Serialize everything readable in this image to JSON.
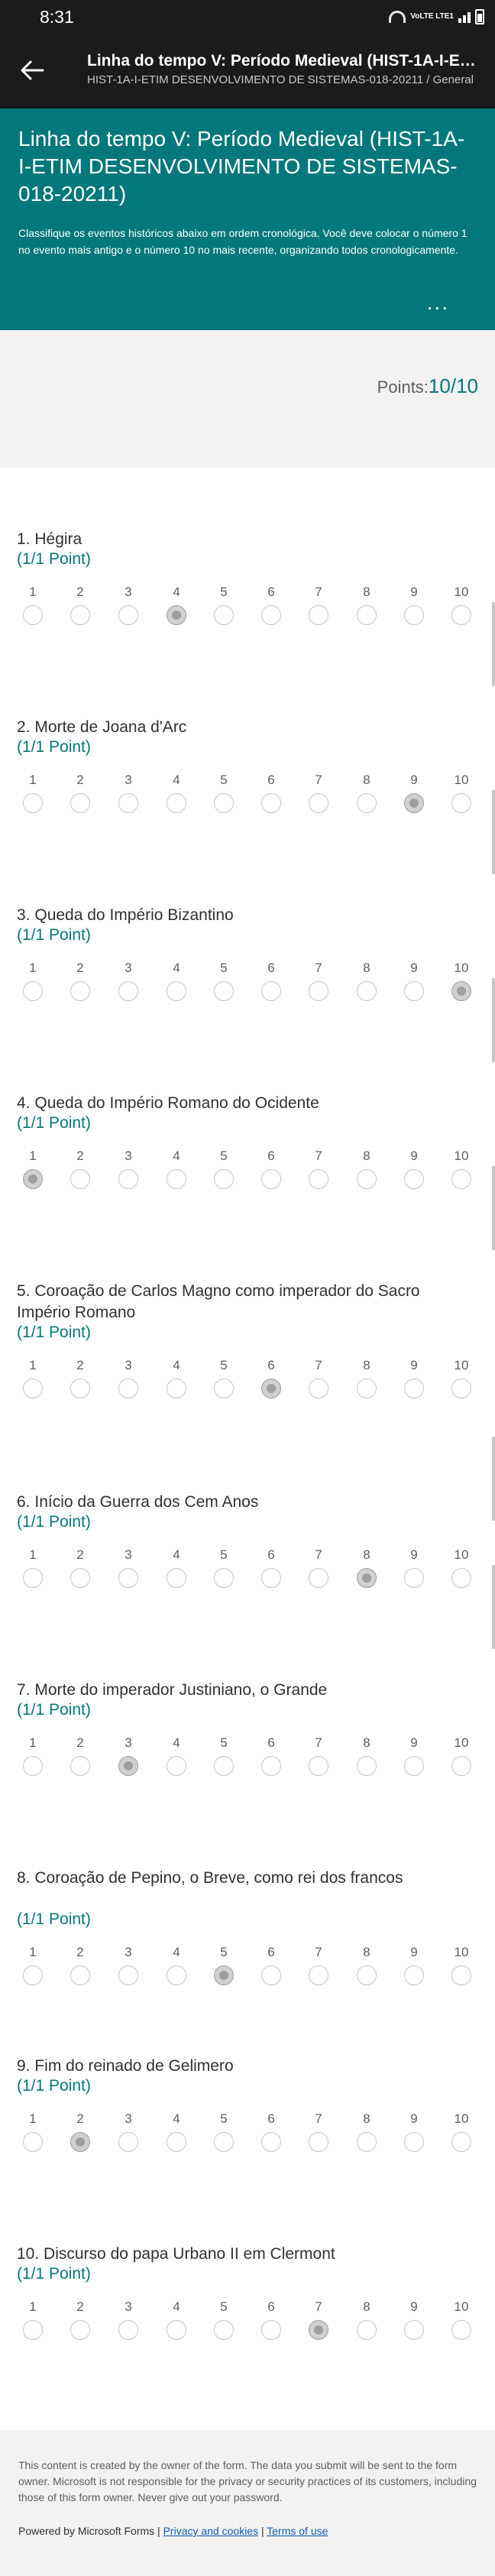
{
  "status_bar": {
    "time": "8:31",
    "network": "VoLTE LTE1"
  },
  "header": {
    "title": "Linha do tempo V: Período Medieval (HIST-1A-I-ETIM DES...",
    "subtitle": "HIST-1A-I-ETIM DESENVOLVIMENTO DE SISTEMAS-018-20211 / General"
  },
  "form": {
    "title": "Linha do tempo V: Período Medieval (HIST-1A-I-ETIM DESENVOLVIMENTO DE SISTEMAS-018-20211)",
    "description": "Classifique os eventos históricos abaixo em ordem cronológica. Você deve colocar o número 1 no evento mais antigo e o número 10 no mais recente, organizando todos cronologicamente.",
    "more_label": "...",
    "points_label": "Points:",
    "points_value": "10/10",
    "accent_color": "#03787c"
  },
  "scale_labels": [
    "1",
    "2",
    "3",
    "4",
    "5",
    "6",
    "7",
    "8",
    "9",
    "10"
  ],
  "questions": [
    {
      "number": "1.",
      "title": "Hégira",
      "points": "(1/1 Point)",
      "selected": 4
    },
    {
      "number": "2.",
      "title": "Morte de Joana d'Arc",
      "points": "(1/1 Point)",
      "selected": 9
    },
    {
      "number": "3.",
      "title": "Queda do Império Bizantino",
      "points": "(1/1 Point)",
      "selected": 10
    },
    {
      "number": "4.",
      "title": "Queda do Império Romano do Ocidente",
      "points": "(1/1 Point)",
      "selected": 1
    },
    {
      "number": "5.",
      "title": "Coroação de Carlos Magno como imperador do Sacro Império Romano",
      "points": "(1/1 Point)",
      "selected": 6
    },
    {
      "number": "6.",
      "title": "Início da Guerra dos Cem Anos",
      "points": "(1/1 Point)",
      "selected": 8
    },
    {
      "number": "7.",
      "title": "Morte do imperador Justiniano, o Grande",
      "points": "(1/1 Point)",
      "selected": 3
    },
    {
      "number": "8.",
      "title": "Coroação de Pepino, o Breve, como rei dos francos",
      "points": "(1/1 Point)",
      "selected": 5
    },
    {
      "number": "9.",
      "title": "Fim do reinado de Gelimero",
      "points": "(1/1 Point)",
      "selected": 2
    },
    {
      "number": "10.",
      "title": "Discurso do papa Urbano II em Clermont",
      "points": "(1/1 Point)",
      "selected": 7
    }
  ],
  "footer": {
    "disclaimer": "This content is created by the owner of the form. The data you submit will be sent to the form owner. Microsoft is not responsible for the privacy or security practices of its customers, including those of this form owner. Never give out your password.",
    "powered_by": "Powered by Microsoft Forms |",
    "privacy_link": "Privacy and cookies",
    "separator": "|",
    "terms_link": "Terms of use"
  }
}
